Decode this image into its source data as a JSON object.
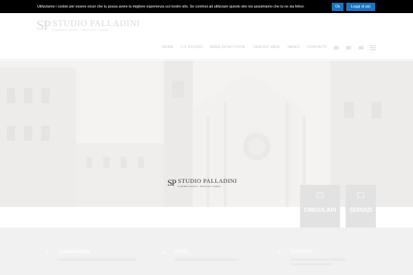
{
  "cookie_bar": {
    "text": "Utilizziamo i cookie per essere sicuri che tu possa avere la migliore esperienza sul nostro sito. Se continui ad utilizzare questo sito noi assumiamo che tu ne sia felice.",
    "ok_label": "Ok",
    "more_label": "Leggi di più"
  },
  "header": {
    "logo": {
      "mark": "SP",
      "name": "STUDIO PALLADINI",
      "tagline": "Commercialisti / Revisori Legali"
    },
    "nav": [
      {
        "label": "HOME"
      },
      {
        "label": "LO STUDIO"
      },
      {
        "label": "AREE DI ATTIVITÀ"
      },
      {
        "label": "SERVIZI WEB"
      },
      {
        "label": "NEWS"
      },
      {
        "label": "CONTATTI"
      }
    ],
    "flags": [
      {
        "name": "flag-italian-icon"
      },
      {
        "name": "flag-english-icon"
      },
      {
        "name": "flag-russian-icon"
      }
    ]
  },
  "hero": {
    "logo": {
      "mark": "SP",
      "name": "STUDIO PALLADINI",
      "tagline": "Commercialisti / Revisori Legali"
    },
    "boxes": [
      {
        "label": "CIRCOLARI",
        "icon": "document-icon"
      },
      {
        "label": "SERVIZI",
        "icon": "monitor-icon"
      }
    ]
  },
  "footer": {
    "columns": [
      {
        "title": "CONSULENZE",
        "icon": "facebook-icon"
      },
      {
        "title": "DOVE",
        "icon": "twitter-icon"
      },
      {
        "title": "CONTATTI",
        "icon": "phone-icon"
      }
    ]
  },
  "colors": {
    "cookie_background": "#000000",
    "cookie_button": "#1e73be",
    "footer_background": "#f1f1f1"
  }
}
